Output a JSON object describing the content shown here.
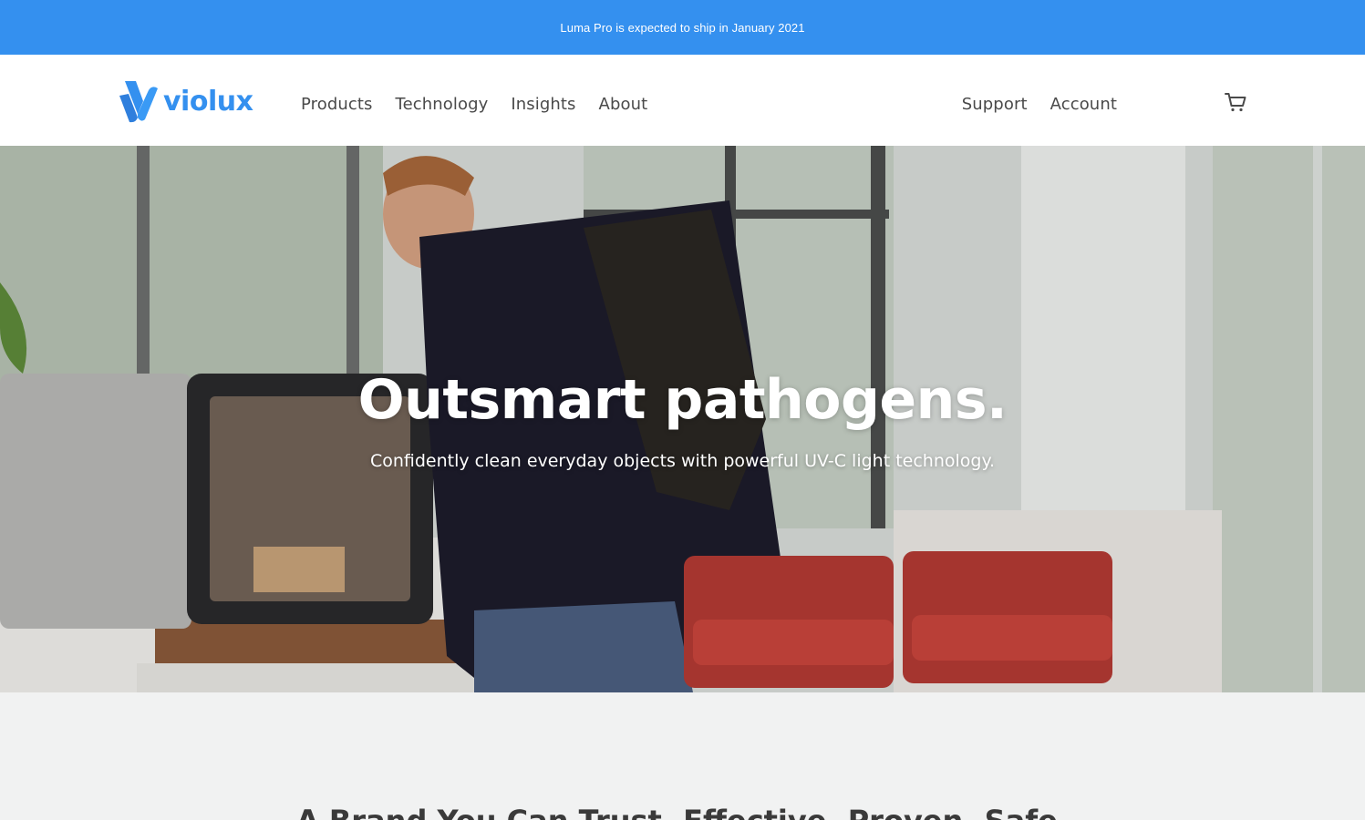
{
  "announcement": {
    "text": "Luma Pro is expected to ship in January 2021"
  },
  "brand": {
    "name": "violux",
    "logo_icon": "violux-logo-icon",
    "color": "#3490ef"
  },
  "nav": {
    "left": [
      {
        "label": "Products"
      },
      {
        "label": "Technology"
      },
      {
        "label": "Insights"
      },
      {
        "label": "About"
      }
    ],
    "right": [
      {
        "label": "Support"
      },
      {
        "label": "Account"
      }
    ],
    "cart_icon": "cart-icon"
  },
  "hero": {
    "title": "Outsmart pathogens.",
    "subtitle": "Confidently clean everyday objects with powerful UV-C light technology."
  },
  "section": {
    "title": "A Brand You Can Trust. Effective. Proven. Safe."
  }
}
